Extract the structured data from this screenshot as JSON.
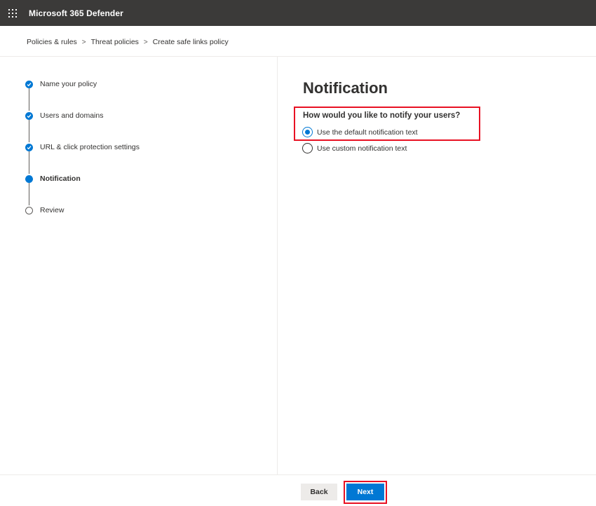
{
  "app": {
    "title": "Microsoft 365 Defender",
    "launcher_icon": "waffle-icon"
  },
  "breadcrumb": {
    "items": [
      "Policies & rules",
      "Threat policies",
      "Create safe links policy"
    ],
    "separator": ">"
  },
  "steps": [
    {
      "label": "Name your policy",
      "state": "completed"
    },
    {
      "label": "Users and domains",
      "state": "completed"
    },
    {
      "label": "URL & click protection settings",
      "state": "completed"
    },
    {
      "label": "Notification",
      "state": "current"
    },
    {
      "label": "Review",
      "state": "not-started"
    }
  ],
  "main": {
    "title": "Notification",
    "question": "How would you like to notify your users?",
    "options": [
      {
        "label": "Use the default notification text",
        "selected": true
      },
      {
        "label": "Use custom notification text",
        "selected": false
      }
    ]
  },
  "footer": {
    "back_label": "Back",
    "next_label": "Next"
  },
  "colors": {
    "topbar": "#3b3a39",
    "accent": "#0078d4",
    "highlight": "#e81123"
  }
}
